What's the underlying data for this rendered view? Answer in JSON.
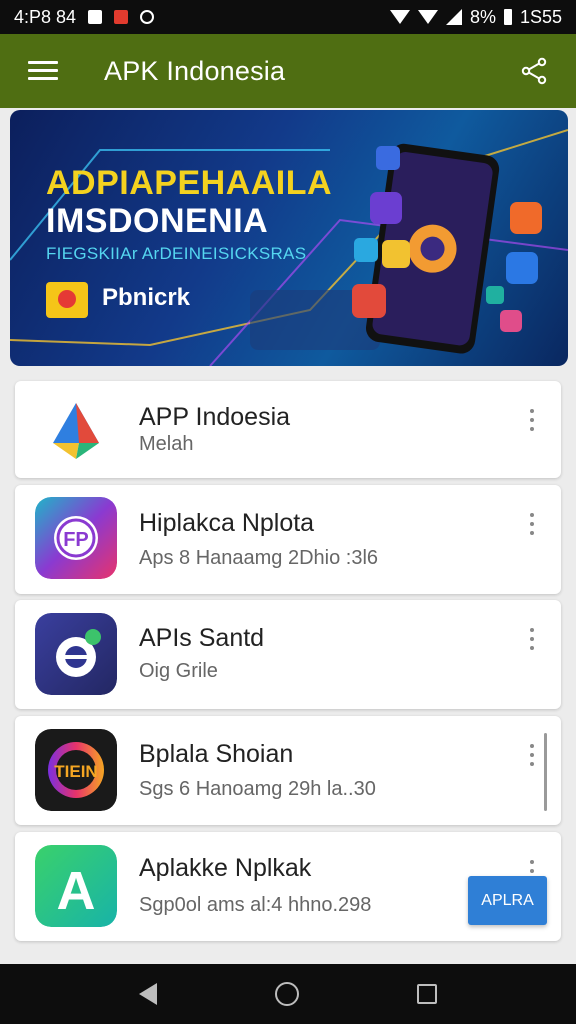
{
  "status_bar": {
    "time": "4:P8 84",
    "battery_text": "8%",
    "clock_right": "1S55",
    "icons": [
      "square-icon",
      "red-flag-icon",
      "ring-icon",
      "wifi-icon",
      "signal-icon",
      "battery-icon"
    ]
  },
  "app_bar": {
    "title": "APK Indonesia",
    "color": "#4f6e12",
    "menu_icon": "hamburger-icon",
    "share_icon": "share-icon"
  },
  "banner": {
    "title_line1": "ADPIAPEHAAILA",
    "title_line2": "IMSDONENIA",
    "subtitle": "FIEGSKIIAr ArDEINEISICKSRAS",
    "brand": "Pbnicrk",
    "title1_color": "#f4d21f",
    "subtitle_color": "#55d6f0"
  },
  "apps": [
    {
      "name": "APP Indoesia",
      "subtitle": "Melah",
      "icon": "colorful-triangle-icon"
    },
    {
      "name": "Hiplakca Nplota",
      "subtitle": "Aps 8 Hanaamg 2Dhio :3l6",
      "icon": "fp-logo-icon"
    },
    {
      "name": "APIs Santd",
      "subtitle": "Oig Grile",
      "icon": "chat-bubble-icon"
    },
    {
      "name": "Bplala Shoian",
      "subtitle": "Sgs 6 Hanoamg 29h la..30",
      "icon": "tien-logo-icon"
    },
    {
      "name": "Aplakke Nplkak",
      "subtitle": "Sgp0ol ams al:4 hhno.298",
      "icon": "letter-a-icon"
    }
  ],
  "install_button": {
    "label": "APLRA",
    "color": "#2f7fd6"
  },
  "nav_bar": {
    "icons": [
      "back-icon",
      "home-icon",
      "recents-icon"
    ]
  }
}
